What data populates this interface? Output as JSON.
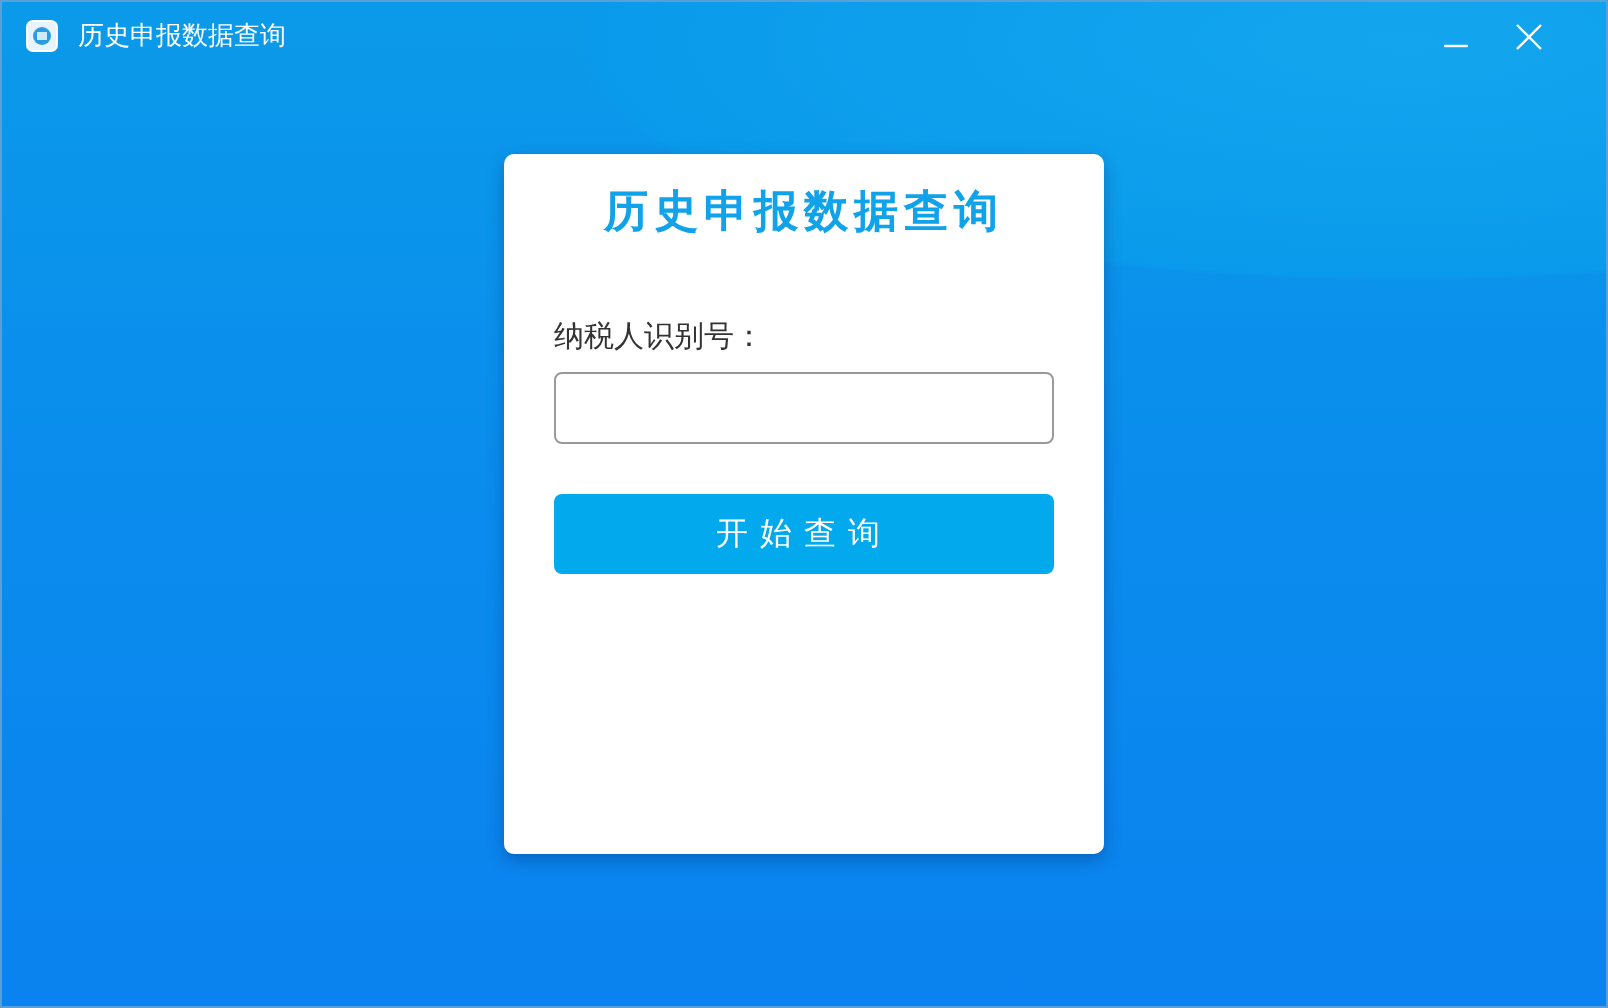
{
  "window": {
    "title": "历史申报数据查询"
  },
  "card": {
    "heading": "历史申报数据查询",
    "field_label": "纳税人识别号：",
    "button": "开始查询"
  }
}
